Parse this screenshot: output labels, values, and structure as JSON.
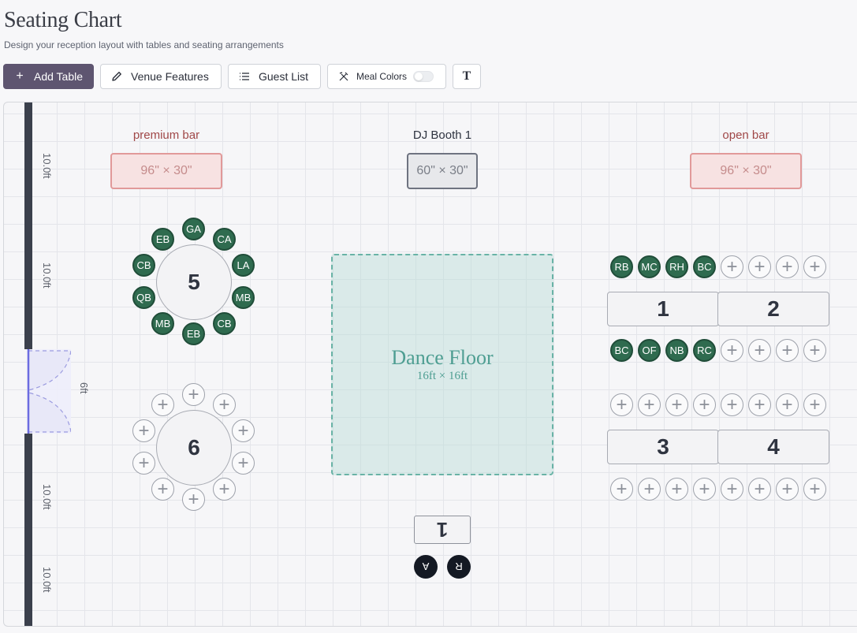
{
  "header": {
    "title": "Seating Chart",
    "subtitle": "Design your reception layout with tables and seating arrangements"
  },
  "toolbar": {
    "add_table": "Add Table",
    "venue_features": "Venue Features",
    "guest_list": "Guest List",
    "meal_colors": "Meal Colors",
    "meal_colors_on": false,
    "text_tool": "T"
  },
  "walls": {
    "segment_labels": [
      "10.0ft",
      "10.0ft",
      "10.0ft",
      "10.0ft"
    ],
    "door_label": "6ft"
  },
  "features": {
    "premium_bar": {
      "label": "premium bar",
      "size": "96\" × 30\""
    },
    "dj_booth": {
      "label": "DJ Booth 1",
      "size": "60\" × 30\""
    },
    "open_bar": {
      "label": "open bar",
      "size": "96\" × 30\""
    }
  },
  "dance_floor": {
    "name": "Dance Floor",
    "size": "16ft × 16ft"
  },
  "round_tables": [
    {
      "number": "5",
      "seats": [
        "GA",
        "CA",
        "LA",
        "MB",
        "CB",
        "EB",
        "MB",
        "QB",
        "CB",
        "EB"
      ]
    },
    {
      "number": "6",
      "seats": [
        "+",
        "+",
        "+",
        "+",
        "+",
        "+",
        "+",
        "+",
        "+",
        "+"
      ]
    }
  ],
  "rect_tables": [
    {
      "number": "1",
      "top_seats": [
        "RB",
        "MC",
        "RH",
        "BC"
      ],
      "bottom_seats": [
        "BC",
        "OF",
        "NB",
        "RC"
      ]
    },
    {
      "number": "2",
      "top_seats": [
        "+",
        "+",
        "+",
        "+"
      ],
      "bottom_seats": [
        "+",
        "+",
        "+",
        "+"
      ]
    },
    {
      "number": "3",
      "top_seats": [
        "+",
        "+",
        "+",
        "+"
      ],
      "bottom_seats": [
        "+",
        "+",
        "+",
        "+"
      ]
    },
    {
      "number": "4",
      "top_seats": [
        "+",
        "+",
        "+",
        "+"
      ],
      "bottom_seats": [
        "+",
        "+",
        "+",
        "+"
      ]
    }
  ],
  "head_table": {
    "number": "1",
    "seats": [
      "A",
      "R"
    ]
  },
  "colors": {
    "primary_button": "#5e5570",
    "filled_seat": "#2f6b4f",
    "bar_fill": "#f7e2e2",
    "dance_floor": "#69b3a6"
  }
}
